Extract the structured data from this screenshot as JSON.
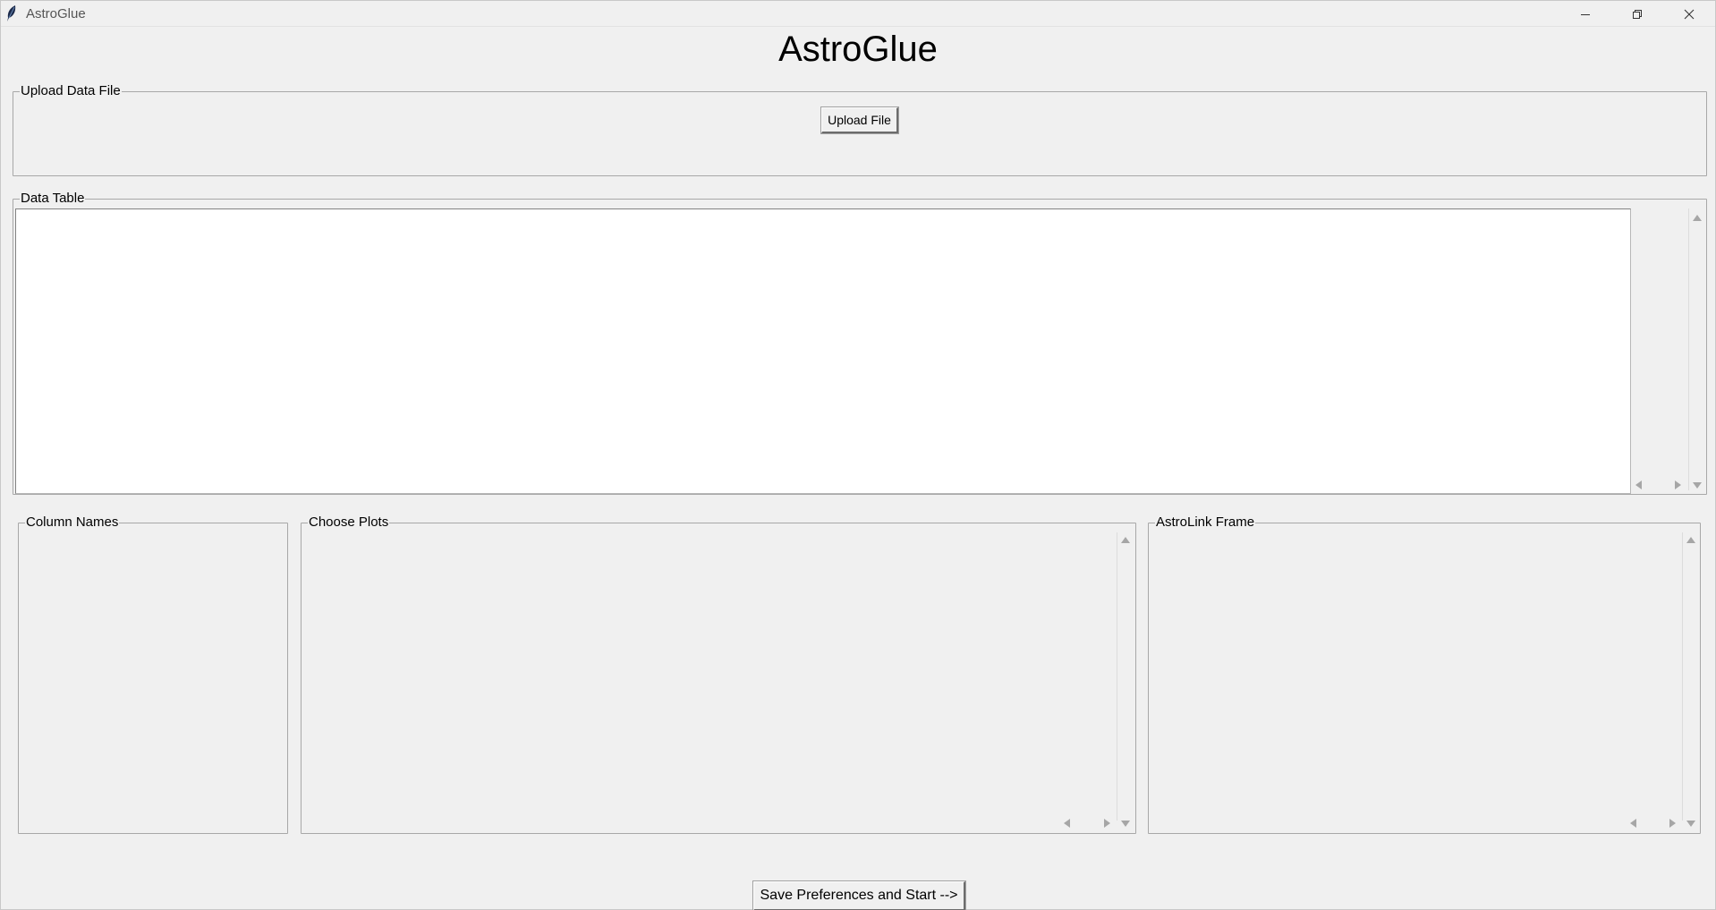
{
  "window": {
    "title": "AstroGlue",
    "icons": {
      "app": "feather-icon",
      "minimize": "minimize-icon",
      "restore": "restore-icon",
      "close": "close-icon"
    }
  },
  "heading": "AstroGlue",
  "upload": {
    "group_label": "Upload Data File",
    "button_label": "Upload File"
  },
  "data_table": {
    "group_label": "Data Table"
  },
  "column_names": {
    "group_label": "Column Names"
  },
  "choose_plots": {
    "group_label": "Choose Plots"
  },
  "astrolink": {
    "group_label": "AstroLink Frame"
  },
  "start_button": {
    "label": "Save Preferences and Start -->"
  }
}
